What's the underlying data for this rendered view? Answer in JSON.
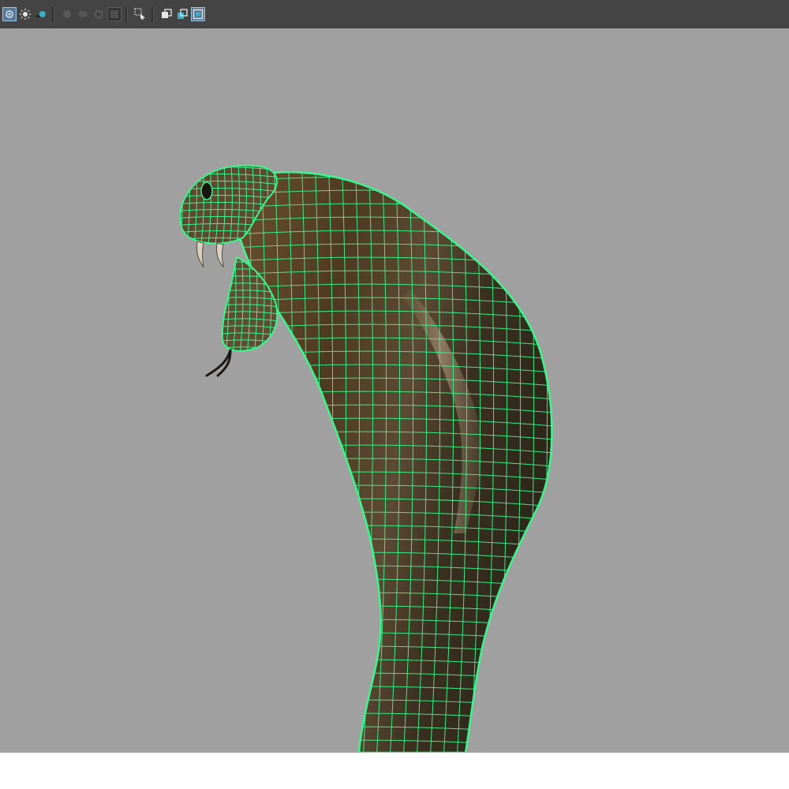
{
  "app": {
    "type": "3d-modeling-viewport",
    "background_color": "#a0a0a0",
    "toolbar_color": "#444444",
    "wireframe_color": "#3cf58c"
  },
  "toolbar": {
    "buttons": [
      {
        "icon": "camera-toggle-icon",
        "active": true
      },
      {
        "icon": "light-sun-icon",
        "active": false
      },
      {
        "icon": "shadow-sphere-icon",
        "active": false
      },
      {
        "icon": "ambient-occlusion-icon",
        "active": false
      },
      {
        "icon": "motion-blur-icon",
        "active": false
      },
      {
        "icon": "anti-aliasing-icon",
        "active": false
      },
      {
        "icon": "depth-of-field-icon",
        "active": false
      },
      {
        "icon": "isolate-select-icon",
        "active": false
      },
      {
        "icon": "xray-icon",
        "active": false
      },
      {
        "icon": "xray-joints-icon",
        "active": false
      },
      {
        "icon": "xray-active-components-icon",
        "active": true
      }
    ]
  },
  "scene": {
    "model": "cobra-mesh",
    "display_mode": "textured-wireframe-on-shaded"
  }
}
